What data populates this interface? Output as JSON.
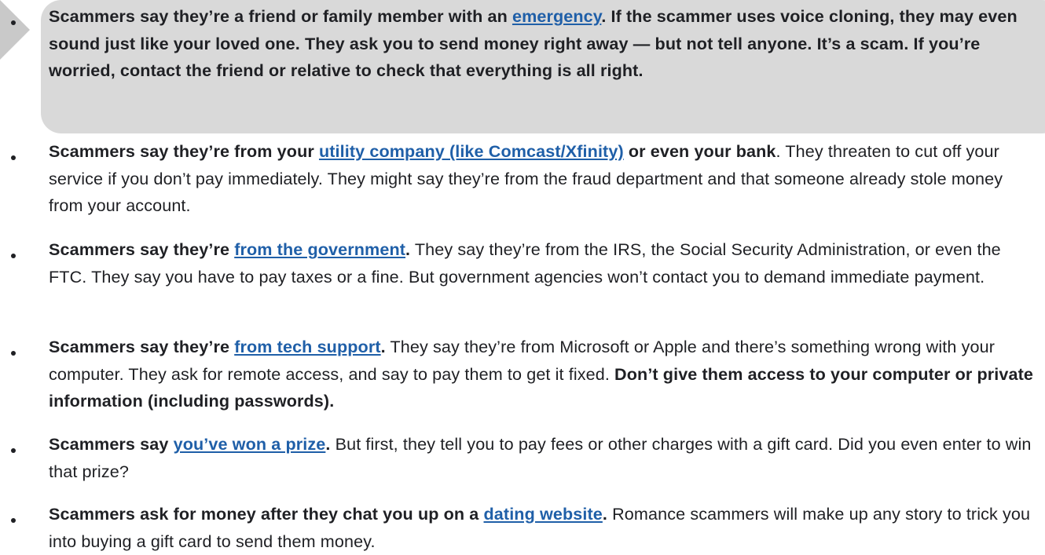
{
  "items": [
    {
      "bold_intro": "Scammers say they’re a friend or family member with an ",
      "link": "emergency",
      "bold_rest": ". If the scammer uses voice cloning, they may even sound just like your loved one. They ask you to send money right away — but not tell anyone. It’s a scam. If you’re worried, contact the friend or relative to check that everything is all right."
    },
    {
      "bold_intro": "Scammers say they’re from your ",
      "link": "utility company (like Comcast/Xfinity)",
      "bold_after_link": " or even your bank",
      "body": ". They threaten to cut off your service if you don’t pay immediately. They might say they’re from the fraud department and that someone already stole money from your account."
    },
    {
      "bold_intro": "Scammers say they’re ",
      "link": "from the government",
      "bold_after_link": ".",
      "body": " They say they’re from the IRS, the Social Security Administration, or even the FTC. They say you have to pay taxes or a fine. But government agencies won’t contact you to demand immediate payment."
    },
    {
      "bold_intro": "Scammers say they’re ",
      "link": "from tech support",
      "bold_after_link": ".",
      "body": " They say they’re from Microsoft or Apple and there’s something wrong with your computer. They ask for remote access, and say to pay them to get it fixed. ",
      "bold_end": "Don’t give them access to your computer or private information (including passwords)."
    },
    {
      "bold_intro": "Scammers say ",
      "link": "you’ve won a prize",
      "bold_after_link": ".",
      "body": " But first, they tell you to pay fees or other charges with a gift card. Did you even enter to win that prize?"
    },
    {
      "bold_intro": "Scammers ask for money after they chat you up on a ",
      "link": "dating website",
      "bold_after_link": ".",
      "body": " Romance scammers will make up any story to trick you into buying a gift card to send them money."
    }
  ],
  "colors": {
    "highlight": "#d9d9d9",
    "link": "#1f5fa8",
    "text": "#1f2024"
  }
}
